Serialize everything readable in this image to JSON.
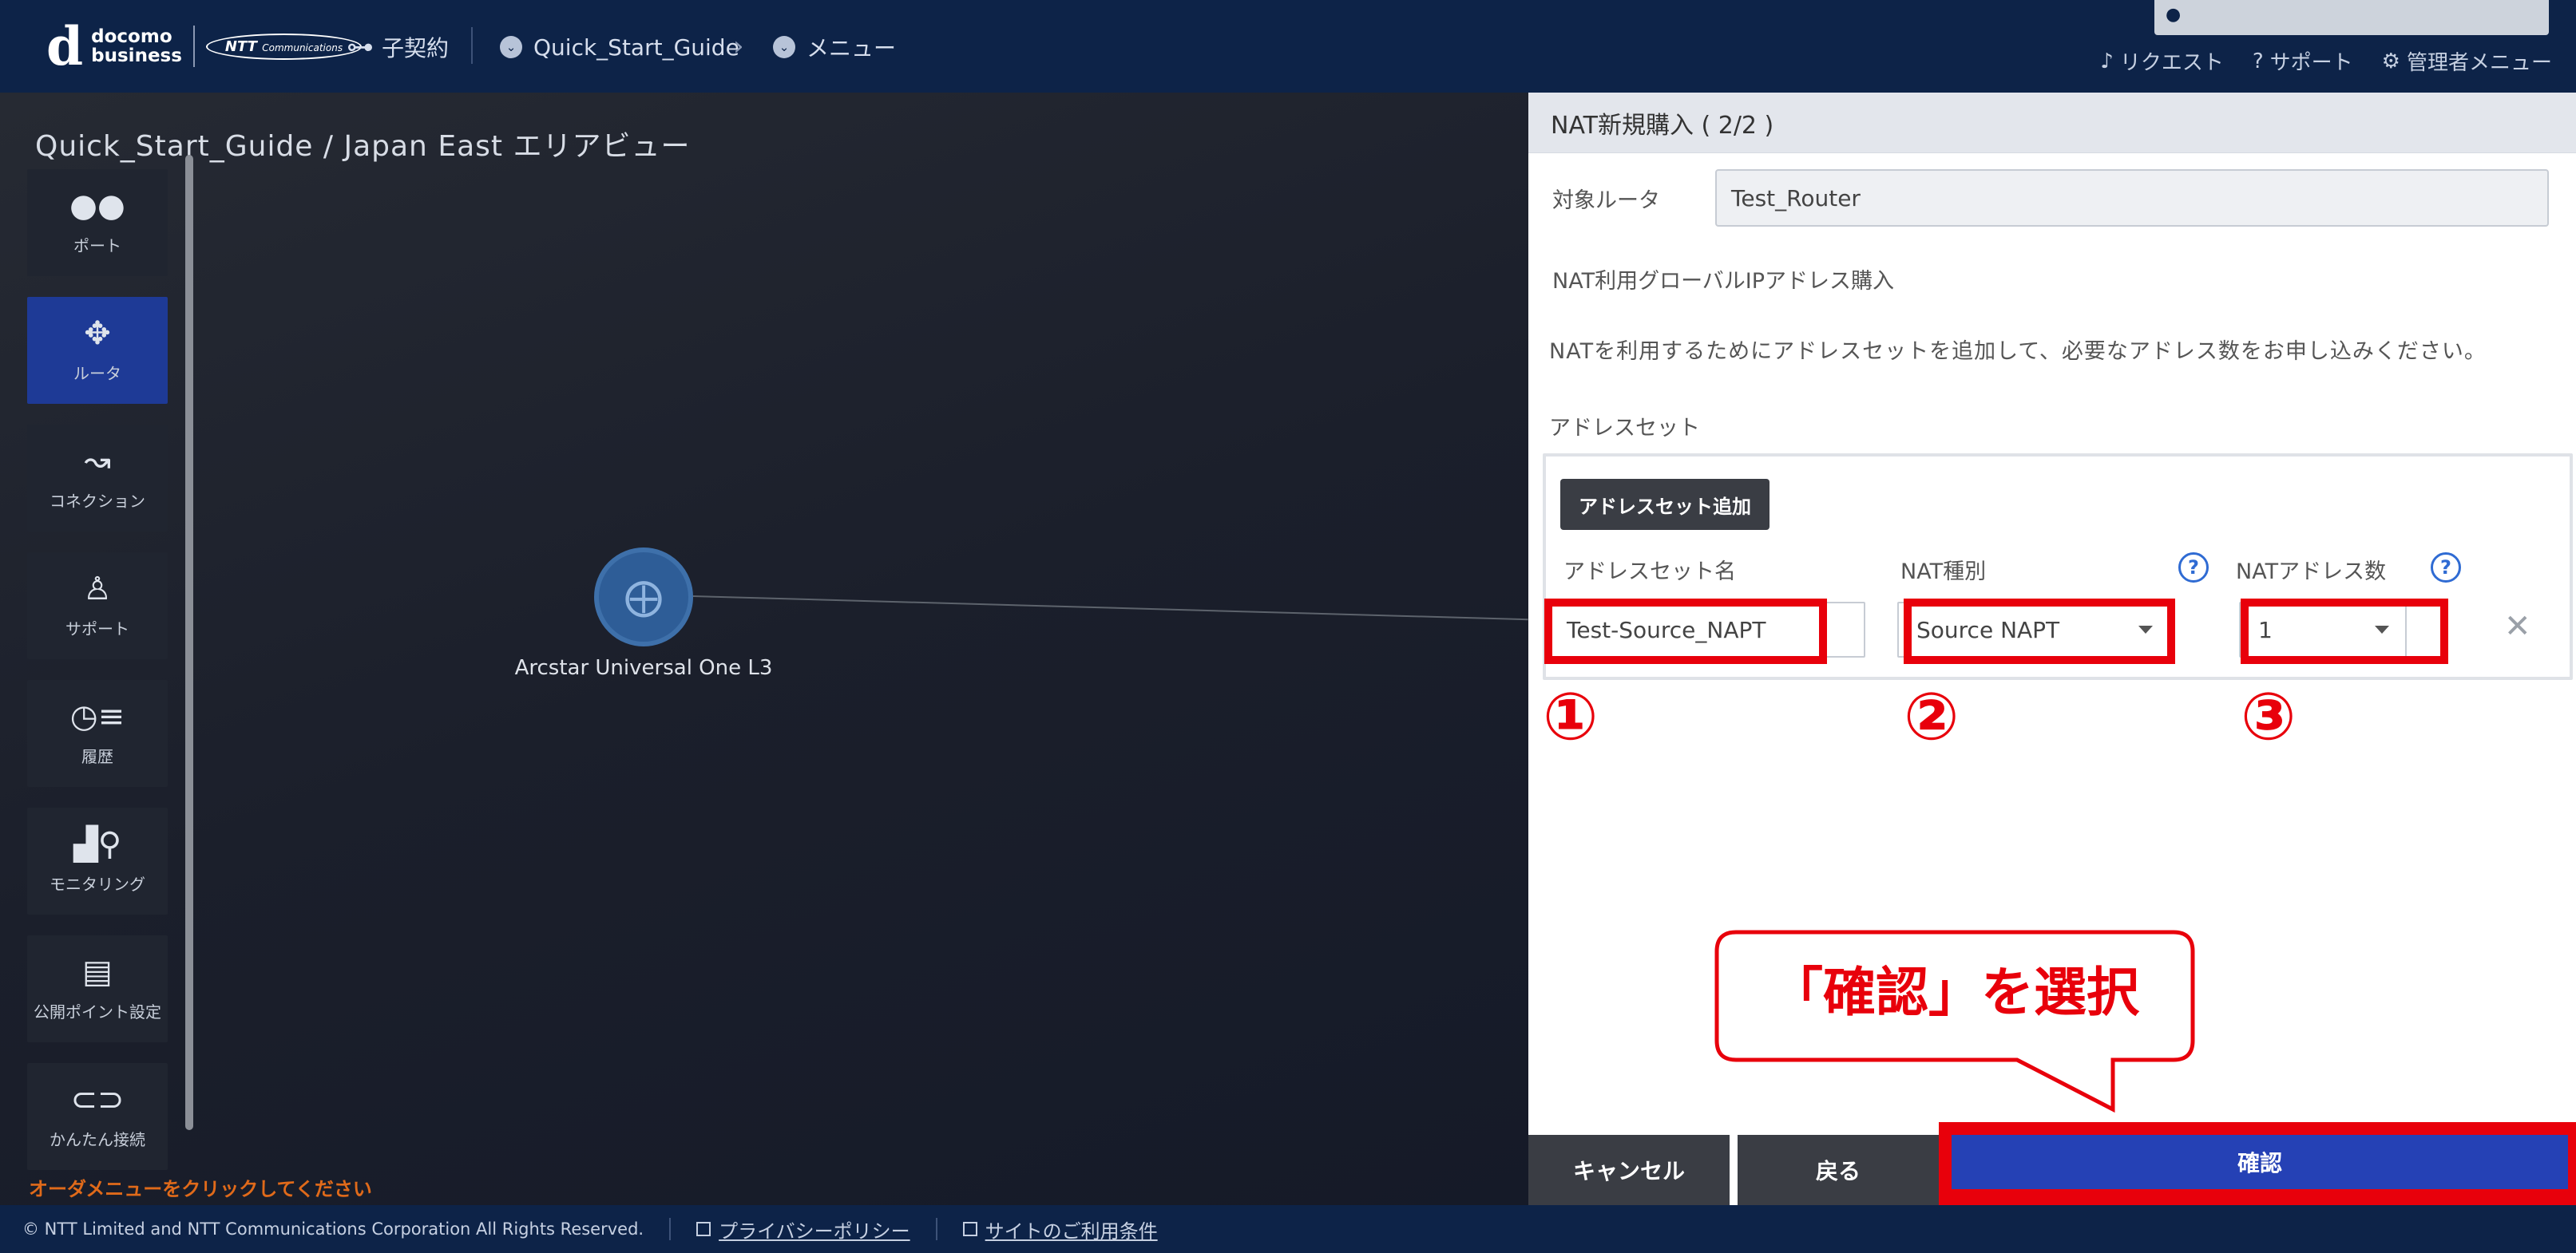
{
  "header": {
    "logo": {
      "brand_line1": "docomo",
      "brand_line2": "business",
      "partner": "NTT",
      "partner_sub": "Communications"
    },
    "sub_contract": "子契約",
    "contract_name": "Quick_Start_Guide",
    "menu": "メニュー",
    "user_name": "",
    "links": {
      "request": "リクエスト",
      "support": "サポート",
      "admin_menu": "管理者メニュー"
    }
  },
  "map": {
    "title": "Quick_Start_Guide / Japan East エリアビュー",
    "sidebar": [
      {
        "label": "ポート",
        "icon": "port-icon"
      },
      {
        "label": "ルータ",
        "icon": "router-icon",
        "active": true
      },
      {
        "label": "コネクション",
        "icon": "connection-icon"
      },
      {
        "label": "サポート",
        "icon": "support-user-icon"
      },
      {
        "label": "履歴",
        "icon": "history-icon"
      },
      {
        "label": "モニタリング",
        "icon": "monitoring-icon"
      },
      {
        "label": "公開ポイント設定",
        "icon": "public-point-icon"
      },
      {
        "label": "かんたん接続",
        "icon": "easy-connect-icon"
      }
    ],
    "node_label": "Arcstar Universal One L3",
    "order_hint": "オーダメニューをクリックしてください"
  },
  "panel": {
    "title": "NAT新規購入 ( 2/2 )",
    "router_label": "対象ルータ",
    "router_value": "Test_Router",
    "section_title": "NAT利用グローバルIPアドレス購入",
    "description": "NATを利用するためにアドレスセットを追加して、必要なアドレス数をお申し込みください。",
    "address_set_label": "アドレスセット",
    "add_button": "アドレスセット追加",
    "columns": {
      "name": "アドレスセット名",
      "type": "NAT種別",
      "count": "NATアドレス数"
    },
    "help_glyph": "?",
    "row": {
      "name": "Test-Source_NAPT",
      "type": "Source NAPT",
      "count": "1"
    },
    "markers": [
      "①",
      "②",
      "③"
    ],
    "callout": "「確認」を選択",
    "buttons": {
      "cancel": "キャンセル",
      "back": "戻る",
      "confirm": "確認"
    }
  },
  "footer": {
    "copyright": "© NTT Limited and NTT Communications Corporation All Rights Reserved.",
    "privacy": "プライバシーポリシー",
    "terms": "サイトのご利用条件"
  },
  "colors": {
    "header_bg": "#0d2348",
    "accent_blue": "#2541b5",
    "highlight_red": "#e8000b",
    "active_sidebar": "#1e3a96"
  }
}
